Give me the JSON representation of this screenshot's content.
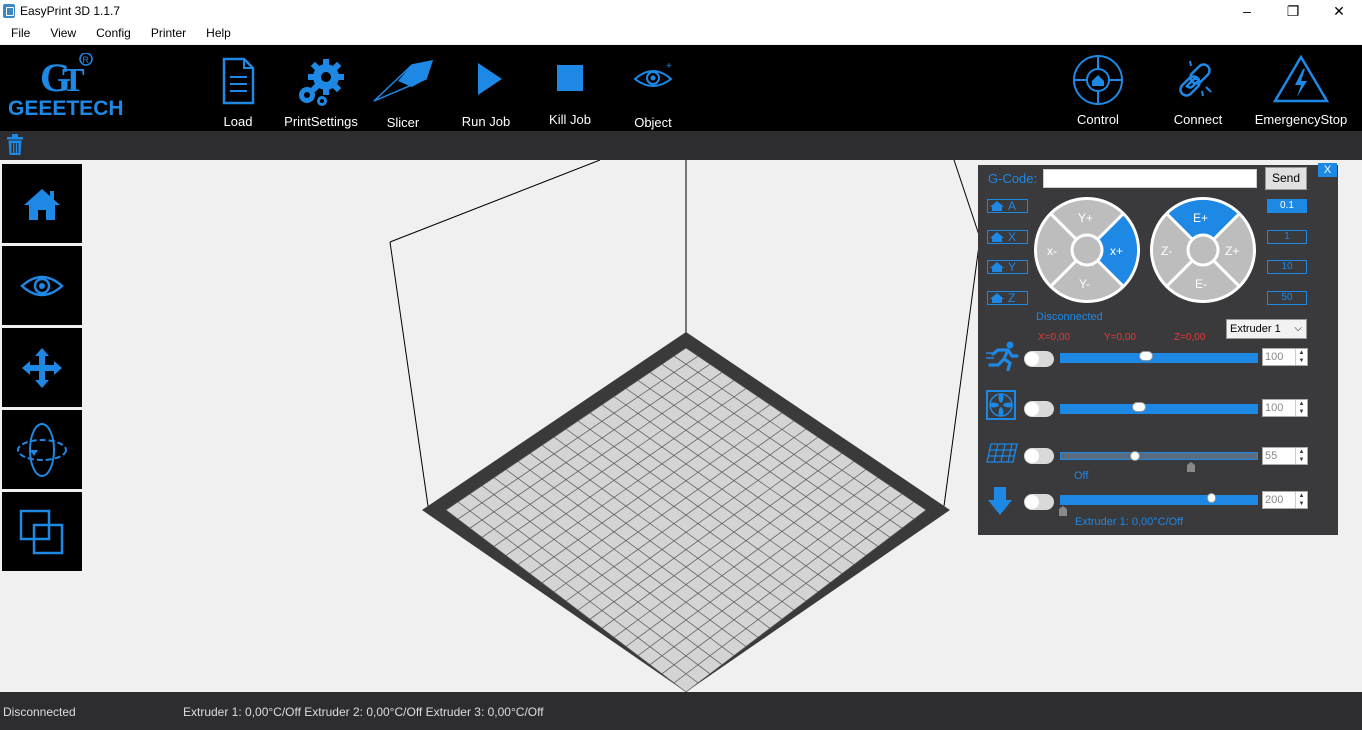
{
  "window": {
    "title": "EasyPrint 3D  1.1.7",
    "minimize": "–",
    "maximize": "❐",
    "close": "✕"
  },
  "menu": [
    "File",
    "View",
    "Config",
    "Printer",
    "Help"
  ],
  "brand": {
    "logo_text": "GEEETECH"
  },
  "toolbar": {
    "load": "Load",
    "print_settings": "PrintSettings",
    "slicer": "Slicer",
    "run_job": "Run Job",
    "kill_job": "Kill Job",
    "object": "Object",
    "control": "Control",
    "connect": "Connect",
    "emergency_stop": "EmergencyStop"
  },
  "panel": {
    "close": "X",
    "gcode_label": "G-Code:",
    "gcode_value": "",
    "send": "Send",
    "home_axes": [
      "A",
      "X",
      "Y",
      "Z"
    ],
    "steps": [
      "0.1",
      "1",
      "10",
      "50"
    ],
    "selected_step": "0.1",
    "xy_pad": {
      "up": "Y+",
      "down": "Y-",
      "left": "x-",
      "right": "x+"
    },
    "ze_pad": {
      "up": "E+",
      "down": "E-",
      "left": "Z-",
      "right": "Z+"
    },
    "status": "Disconnected",
    "coords": {
      "x": "X=0,00",
      "y": "Y=0,00",
      "z": "Z=0,00"
    },
    "extruder_select": "Extruder 1",
    "speed": {
      "value": "100",
      "fraction": 0.43
    },
    "fan": {
      "value": "100",
      "fraction": 0.39
    },
    "bed": {
      "value": "55",
      "fraction": 0.37,
      "label": "Off"
    },
    "extruder": {
      "value": "200",
      "fraction": 0.78,
      "label": "Extruder 1: 0,00°C/Off"
    }
  },
  "colors": {
    "accent": "#1e88e5",
    "toolbar": "#000000",
    "panel": "#3a3a3d",
    "warn": "#e53935"
  },
  "statusbar": {
    "connection": "Disconnected",
    "extruders": "Extruder 1: 0,00°C/Off Extruder 2: 0,00°C/Off Extruder 3: 0,00°C/Off"
  }
}
